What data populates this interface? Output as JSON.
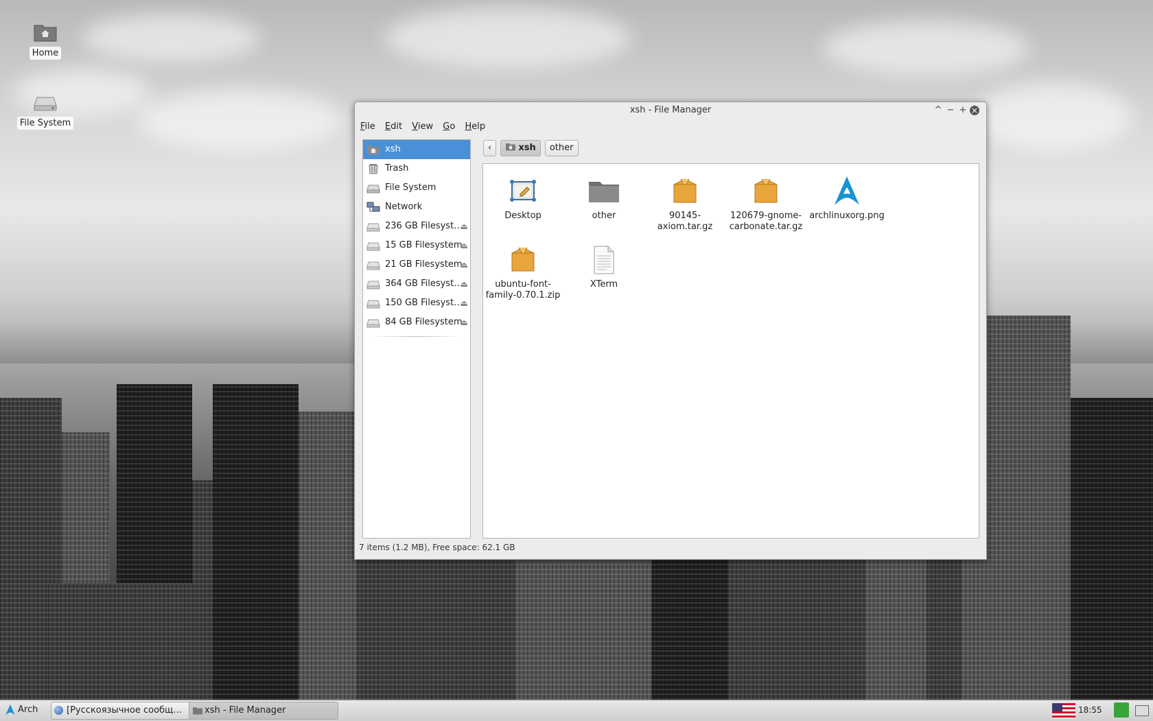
{
  "desktop": {
    "icons": [
      {
        "label": "Home"
      },
      {
        "label": "File System"
      }
    ]
  },
  "window": {
    "title": "xsh - File Manager",
    "buttons": {
      "maximize_up": "^",
      "minimize": "−",
      "maximize": "+",
      "close": "×"
    }
  },
  "menu": [
    {
      "u": "F",
      "rest": "ile"
    },
    {
      "u": "E",
      "rest": "dit"
    },
    {
      "u": "V",
      "rest": "iew"
    },
    {
      "u": "G",
      "rest": "o"
    },
    {
      "u": "H",
      "rest": "elp"
    }
  ],
  "sidebar": {
    "items": [
      {
        "label": "xsh",
        "icon": "home-folder-icon",
        "selected": true
      },
      {
        "label": "Trash",
        "icon": "trash-icon"
      },
      {
        "label": "File System",
        "icon": "drive-icon"
      },
      {
        "label": "Network",
        "icon": "network-icon"
      },
      {
        "label": "236 GB Filesyst…",
        "icon": "drive-icon",
        "eject": true
      },
      {
        "label": "15 GB Filesystem",
        "icon": "drive-icon",
        "eject": true
      },
      {
        "label": "21 GB Filesystem",
        "icon": "drive-icon",
        "eject": true
      },
      {
        "label": "364 GB Filesyst…",
        "icon": "drive-icon",
        "eject": true
      },
      {
        "label": "150 GB Filesyst…",
        "icon": "drive-icon",
        "eject": true
      },
      {
        "label": "84 GB Filesystem",
        "icon": "drive-icon",
        "eject": true
      }
    ],
    "eject_glyph": "⏏"
  },
  "pathbar": {
    "back_glyph": "‹",
    "crumbs": [
      "xsh",
      "other"
    ]
  },
  "files": [
    {
      "name": "Desktop",
      "icon": "desktop-folder-icon"
    },
    {
      "name": "other",
      "icon": "folder-icon"
    },
    {
      "name": "90145-\naxiom.tar.gz",
      "icon": "archive-icon"
    },
    {
      "name": "120679-gnome-\ncarbonate.tar.gz",
      "icon": "archive-icon"
    },
    {
      "name": "archlinuxorg.png",
      "icon": "arch-logo-icon"
    },
    {
      "name": "ubuntu-font-\nfamily-0.70.1.zip",
      "icon": "archive-icon"
    },
    {
      "name": "XTerm",
      "icon": "text-file-icon"
    }
  ],
  "status": "7 items (1.2 MB), Free space: 62.1 GB",
  "taskbar": {
    "start_label": "Arch",
    "tasks": [
      {
        "label": "[Русскоязычное сообщ…"
      },
      {
        "label": "xsh - File Manager",
        "active": true
      }
    ],
    "clock": "18:55"
  },
  "colors": {
    "selection": "#4a90d9",
    "arch_blue": "#1793d1",
    "archive_orange": "#e8a53c"
  }
}
